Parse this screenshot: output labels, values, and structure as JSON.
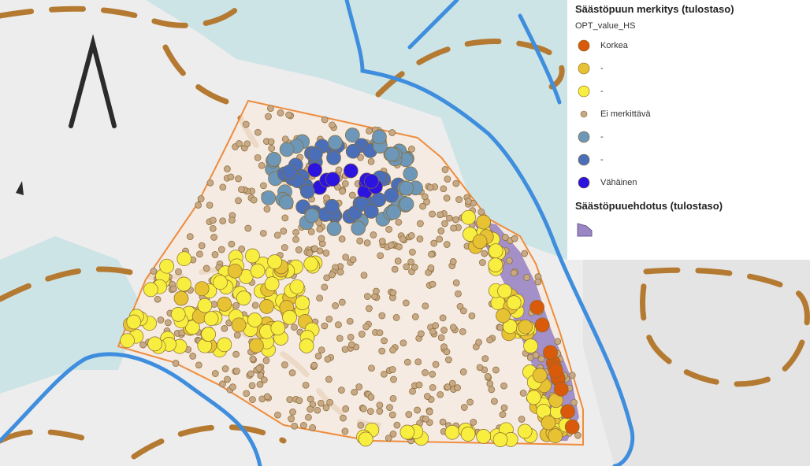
{
  "legend": {
    "layer1": {
      "title": "Säästöpuun merkitys (tulostaso)",
      "field": "OPT_value_HS",
      "classes": [
        {
          "label": "Korkea",
          "color": "#d95a0b",
          "size": "big"
        },
        {
          "label": "-",
          "color": "#e7c233",
          "size": "big"
        },
        {
          "label": "-",
          "color": "#f8ee40",
          "size": "big"
        },
        {
          "label": "Ei merkittävä",
          "color": "#c7a988",
          "size": "small"
        },
        {
          "label": "-",
          "color": "#6d97b8",
          "size": "big"
        },
        {
          "label": "-",
          "color": "#4a6fb8",
          "size": "big"
        },
        {
          "label": "Vähäinen",
          "color": "#2c14e0",
          "size": "big"
        }
      ]
    },
    "layer2": {
      "title": "Säästöpuuehdotus (tulostaso)",
      "swatch_color": "#9b86c4"
    }
  },
  "map": {
    "colors": {
      "background": "#ededed",
      "water": "#cde4e6",
      "stand_fill": "#f6eae0",
      "stand_border": "#ef8c3c",
      "proposal_fill": "#9b86c4",
      "contour": "#b57a32",
      "road": "#3f8ede",
      "north_arrow": "#2b2b2b"
    }
  }
}
